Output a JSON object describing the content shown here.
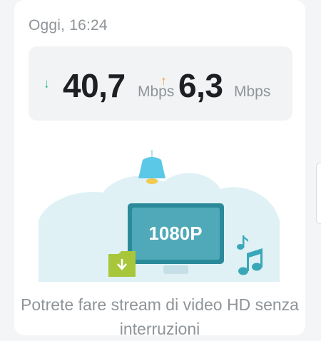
{
  "card": {
    "timestamp": "Oggi, 16:24",
    "download": {
      "value": "40,7",
      "unit": "Mbps",
      "icon": "arrow-down-icon",
      "color": "#2fc28f"
    },
    "upload": {
      "value": "6,3",
      "unit": "Mbps",
      "icon": "arrow-up-icon",
      "color": "#f5a33a"
    },
    "screen_label": "1080P",
    "message": "Potrete fare stream di video HD senza interruzioni"
  },
  "colors": {
    "accent_teal": "#3aa7b8",
    "monitor_dark": "#2b8a9a",
    "folder_lime": "#a8c63a",
    "lamp_blue": "#5cc8e8"
  }
}
